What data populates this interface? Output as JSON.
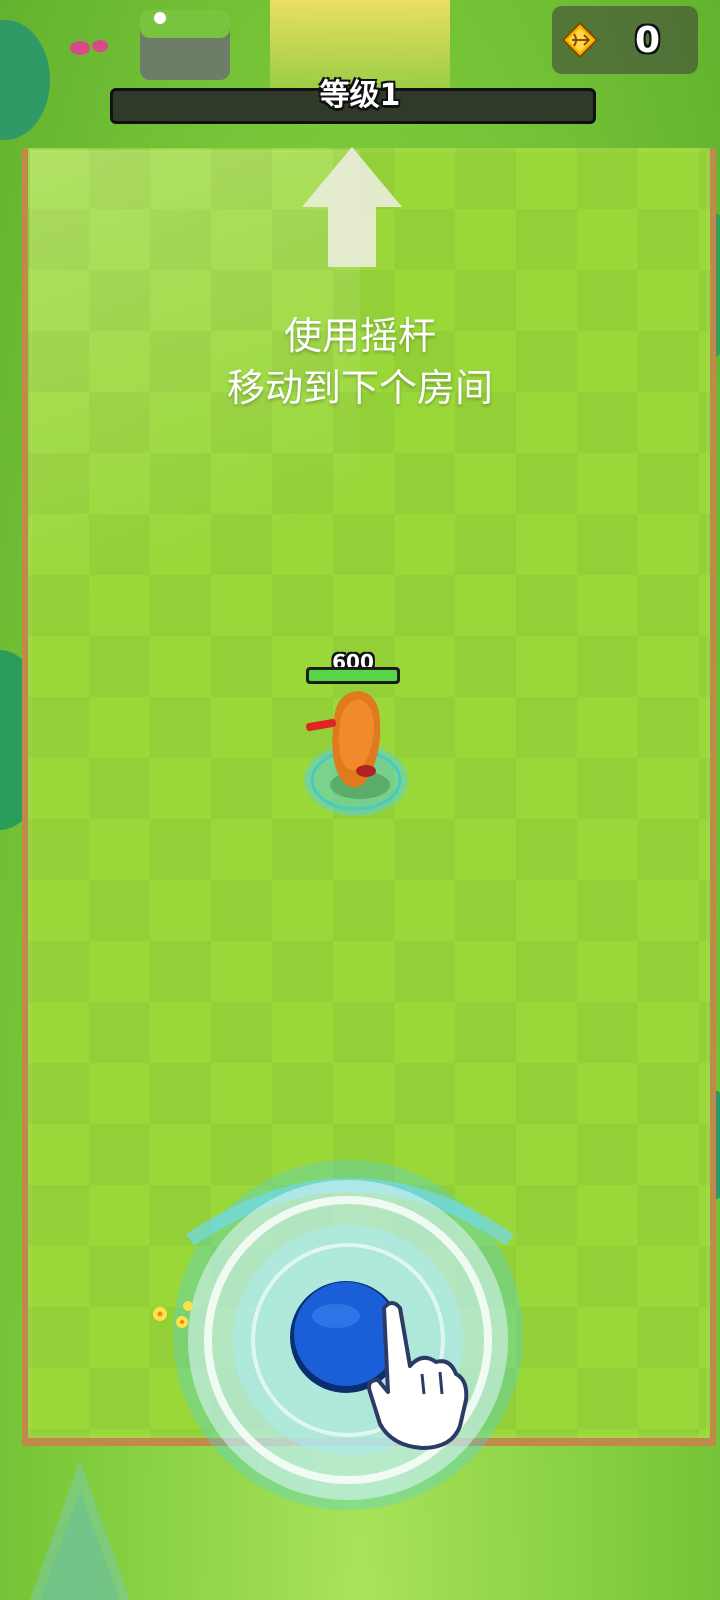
{
  "level": {
    "label": "等级1",
    "progress": 0
  },
  "currency": {
    "icon": "arrow-gem-icon",
    "value": "0"
  },
  "instruction": {
    "line1": "使用摇杆",
    "line2": "移动到下个房间"
  },
  "player": {
    "hp": "600",
    "hp_fraction": 1.0
  },
  "joystick": {
    "icon": "pointing-hand-icon"
  },
  "colors": {
    "grass": "#9ad83a",
    "arena_border": "#c08a4a",
    "hp_green": "#57d44a",
    "joystick_blue": "#1a5fd8"
  }
}
